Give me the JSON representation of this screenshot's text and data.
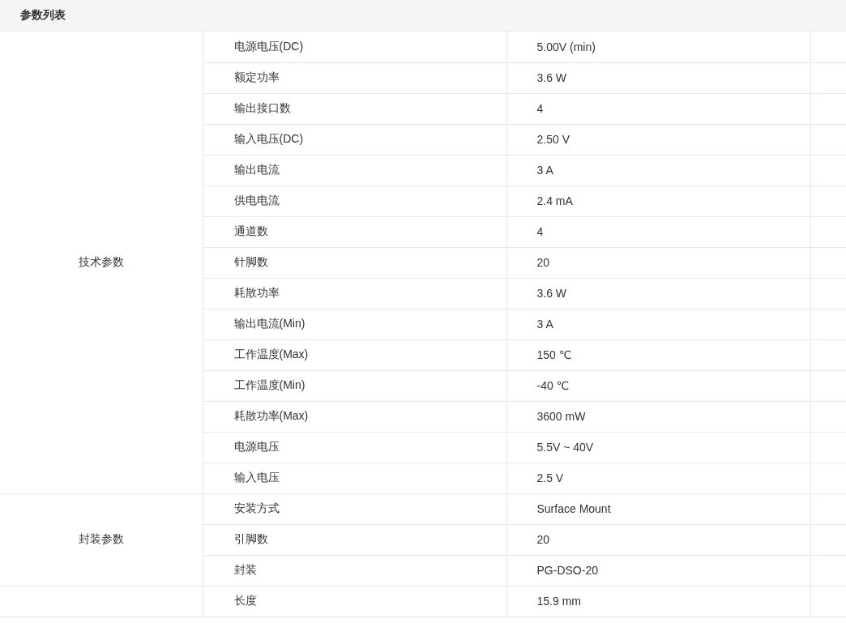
{
  "panel": {
    "title": "参数列表"
  },
  "groups": [
    {
      "label": "技术参数",
      "rows": [
        {
          "name": "电源电压(DC)",
          "value": "5.00V (min)"
        },
        {
          "name": "额定功率",
          "value": "3.6 W"
        },
        {
          "name": "输出接口数",
          "value": "4"
        },
        {
          "name": "输入电压(DC)",
          "value": "2.50 V"
        },
        {
          "name": "输出电流",
          "value": "3 A"
        },
        {
          "name": "供电电流",
          "value": "2.4 mA"
        },
        {
          "name": "通道数",
          "value": "4"
        },
        {
          "name": "针脚数",
          "value": "20"
        },
        {
          "name": "耗散功率",
          "value": "3.6 W"
        },
        {
          "name": "输出电流(Min)",
          "value": "3 A"
        },
        {
          "name": "工作温度(Max)",
          "value": "150 ℃"
        },
        {
          "name": "工作温度(Min)",
          "value": "-40 ℃"
        },
        {
          "name": "耗散功率(Max)",
          "value": "3600 mW"
        },
        {
          "name": "电源电压",
          "value": "5.5V ~ 40V"
        },
        {
          "name": "输入电压",
          "value": "2.5 V"
        }
      ]
    },
    {
      "label": "封装参数",
      "rows": [
        {
          "name": "安装方式",
          "value": "Surface Mount"
        },
        {
          "name": "引脚数",
          "value": "20"
        },
        {
          "name": "封装",
          "value": "PG-DSO-20"
        }
      ]
    },
    {
      "rows": [
        {
          "name": "长度",
          "value": "15.9 mm"
        }
      ]
    }
  ]
}
